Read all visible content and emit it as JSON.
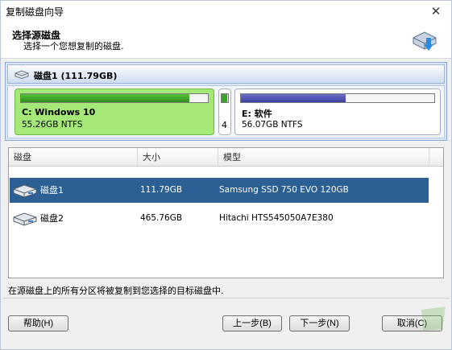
{
  "window": {
    "title": "复制磁盘向导",
    "close_symbol": "✕"
  },
  "header": {
    "title": "选择源磁盘",
    "subtitle": "选择一个您想复制的磁盘."
  },
  "disk_map": {
    "disk_label": "磁盘1 (111.79GB)",
    "partitions": [
      {
        "name": "C: Windows 10",
        "size": "55.26GB NTFS",
        "used_fraction": 0.9,
        "color": "#a6e878"
      },
      {
        "name": "4",
        "size": "",
        "used_fraction": 0.85,
        "color": "#ffffff"
      },
      {
        "name": "E: 软件",
        "size": "56.07GB NTFS",
        "used_fraction": 0.54,
        "color": "#ffffff"
      }
    ]
  },
  "table": {
    "columns": [
      "磁盘",
      "大小",
      "模型"
    ],
    "rows": [
      {
        "name": "磁盘1",
        "size": "111.79GB",
        "model": "Samsung SSD 750 EVO 120GB",
        "selected": true
      },
      {
        "name": "磁盘2",
        "size": "465.76GB",
        "model": "Hitachi HTS545050A7E380",
        "selected": false
      }
    ]
  },
  "status_text": "在源磁盘上的所有分区将被复制到您选择的目标磁盘中.",
  "buttons": {
    "help": "帮助(H)",
    "back": "上一步(B)",
    "next": "下一步(N)",
    "cancel": "取消(C)"
  },
  "icons": {
    "header": "disk-copy-icon",
    "disk": "hard-disk-icon",
    "close": "close-icon"
  },
  "colors": {
    "selected_row": "#2c5f93",
    "partition_c": "#a6e878",
    "used_bar_blue": "#3d3f9e",
    "used_bar_green": "#2f8f1e"
  }
}
